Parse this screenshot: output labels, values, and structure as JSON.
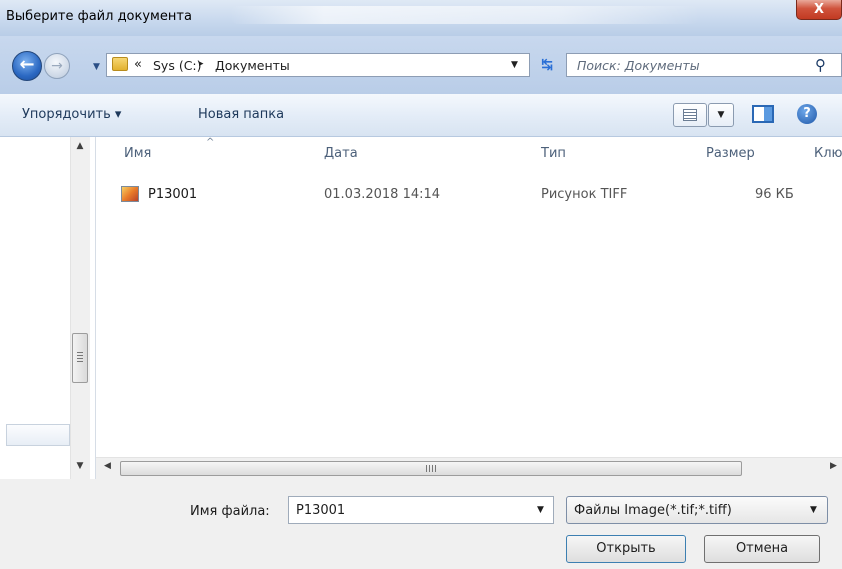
{
  "window": {
    "title": "Выберите файл документа",
    "close_symbol": "X"
  },
  "nav": {
    "back_symbol": "←",
    "forward_symbol": "→",
    "address": {
      "overflow": "«",
      "crumbs": [
        "Sys (C:)",
        "Документы"
      ],
      "separator": "▸"
    },
    "search_placeholder": "Поиск: Документы"
  },
  "toolbar": {
    "organize": "Упорядочить ▾",
    "new_folder": "Новая папка",
    "help": "?"
  },
  "columns": [
    "Имя",
    "Дата",
    "Тип",
    "Размер",
    "Клю"
  ],
  "files": [
    {
      "name": "P13001",
      "date": "01.03.2018 14:14",
      "type": "Рисунок TIFF",
      "size": "96 КБ"
    }
  ],
  "scrollbar": {
    "grip_v": "≡",
    "grip_h": "III"
  },
  "bottom": {
    "filename_label": "Имя файла:",
    "filename_value": "P13001",
    "filter_value": "Файлы Image(*.tif;*.tiff)",
    "open": "Открыть",
    "cancel": "Отмена"
  },
  "colors": {
    "title_bar": "#c9d9ee",
    "close_button": "#c9472f",
    "toolbar": "#e3ecf7",
    "accent": "#2b68c2"
  }
}
